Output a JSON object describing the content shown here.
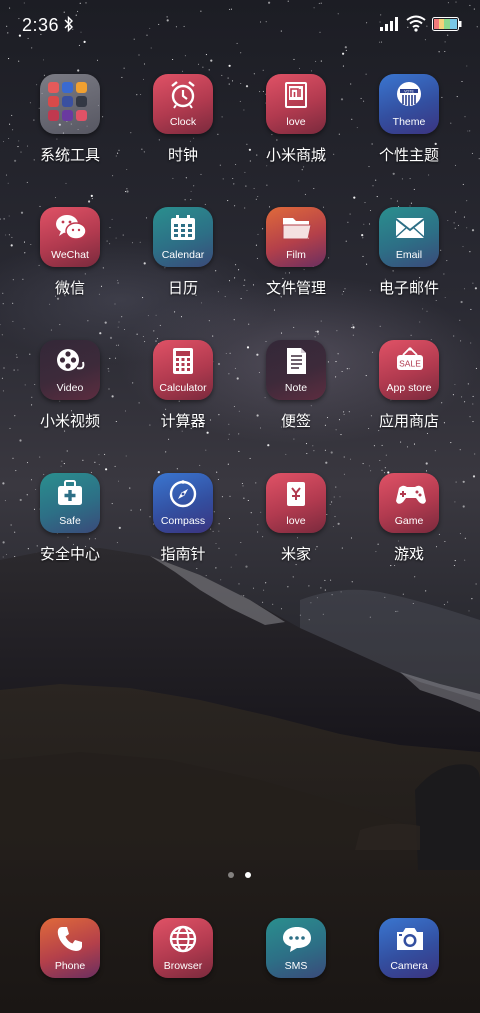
{
  "status_bar": {
    "time": "2:36"
  },
  "apps": [
    {
      "id": "folder-system-tools",
      "name": "系统工具",
      "label": "",
      "style": "folder",
      "icon": "folder-icon"
    },
    {
      "id": "clock",
      "name": "时钟",
      "label": "Clock",
      "style": "g-red",
      "icon": "alarm-clock-icon"
    },
    {
      "id": "mi-store",
      "name": "小米商城",
      "label": "love",
      "style": "g-red",
      "icon": "mi-logo-icon"
    },
    {
      "id": "theme",
      "name": "个性主题",
      "label": "Theme",
      "style": "g-blue",
      "icon": "vote-badge-icon"
    },
    {
      "id": "wechat",
      "name": "微信",
      "label": "WeChat",
      "style": "g-red",
      "icon": "chat-bubbles-icon"
    },
    {
      "id": "calendar",
      "name": "日历",
      "label": "Calendar",
      "style": "g-teal",
      "icon": "calendar-icon"
    },
    {
      "id": "files",
      "name": "文件管理",
      "label": "Film",
      "style": "g-orange",
      "icon": "folder-open-icon"
    },
    {
      "id": "email",
      "name": "电子邮件",
      "label": "Email",
      "style": "g-teal",
      "icon": "envelope-icon"
    },
    {
      "id": "video",
      "name": "小米视频",
      "label": "Video",
      "style": "g-dark",
      "icon": "film-reel-icon"
    },
    {
      "id": "calculator",
      "name": "计算器",
      "label": "Calculator",
      "style": "g-red",
      "icon": "calculator-icon"
    },
    {
      "id": "notes",
      "name": "便签",
      "label": "Note",
      "style": "g-dark",
      "icon": "note-icon"
    },
    {
      "id": "app-store",
      "name": "应用商店",
      "label": "App store",
      "style": "g-red",
      "icon": "sale-tag-icon"
    },
    {
      "id": "security",
      "name": "安全中心",
      "label": "Safe",
      "style": "g-teal",
      "icon": "first-aid-icon"
    },
    {
      "id": "compass",
      "name": "指南针",
      "label": "Compass",
      "style": "g-blue",
      "icon": "compass-icon"
    },
    {
      "id": "mi-home",
      "name": "米家",
      "label": "love",
      "style": "g-red",
      "icon": "mi-home-icon"
    },
    {
      "id": "game",
      "name": "游戏",
      "label": "Game",
      "style": "g-red",
      "icon": "gamepad-icon"
    }
  ],
  "dock": [
    {
      "id": "phone",
      "label": "Phone",
      "style": "g-orange",
      "icon": "phone-icon"
    },
    {
      "id": "browser",
      "label": "Browser",
      "style": "g-red",
      "icon": "globe-icon"
    },
    {
      "id": "sms",
      "label": "SMS",
      "style": "g-teal",
      "icon": "speech-bubble-icon"
    },
    {
      "id": "camera",
      "label": "Camera",
      "style": "g-blue",
      "icon": "camera-icon"
    }
  ],
  "pager": {
    "pages": 2,
    "current": 2
  }
}
